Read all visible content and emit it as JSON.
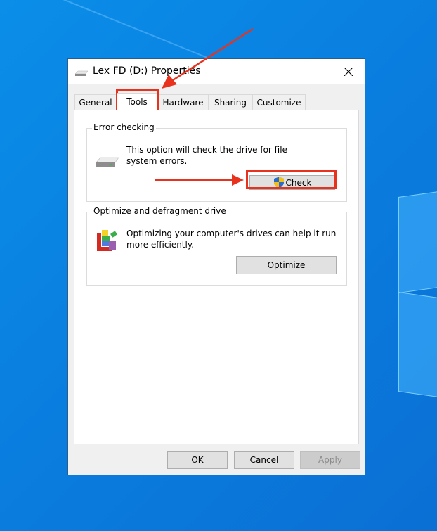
{
  "desktop": {
    "accent": "#0a7fe0"
  },
  "window": {
    "title": "Lex FD (D:) Properties",
    "title_icon": "drive-icon",
    "close_icon": "close-icon"
  },
  "tabs": [
    {
      "label": "General",
      "active": false
    },
    {
      "label": "Tools",
      "active": true
    },
    {
      "label": "Hardware",
      "active": false
    },
    {
      "label": "Sharing",
      "active": false
    },
    {
      "label": "Customize",
      "active": false
    }
  ],
  "error_checking": {
    "group_label": "Error checking",
    "description_line1": "This option will check the drive for file",
    "description_line2": "system errors.",
    "icon": "drive-icon",
    "button_icon": "uac-shield-icon",
    "button_label": "Check"
  },
  "optimize": {
    "group_label": "Optimize and defragment drive",
    "description_line1": "Optimizing your computer's drives can help it run",
    "description_line2": "more efficiently.",
    "icon": "defragment-icon",
    "button_label": "Optimize"
  },
  "footer": {
    "ok_label": "OK",
    "cancel_label": "Cancel",
    "apply_label": "Apply",
    "apply_enabled": false
  },
  "annotations": {
    "highlight_color": "#e8321e",
    "highlighted": [
      "Tools",
      "Check"
    ]
  }
}
